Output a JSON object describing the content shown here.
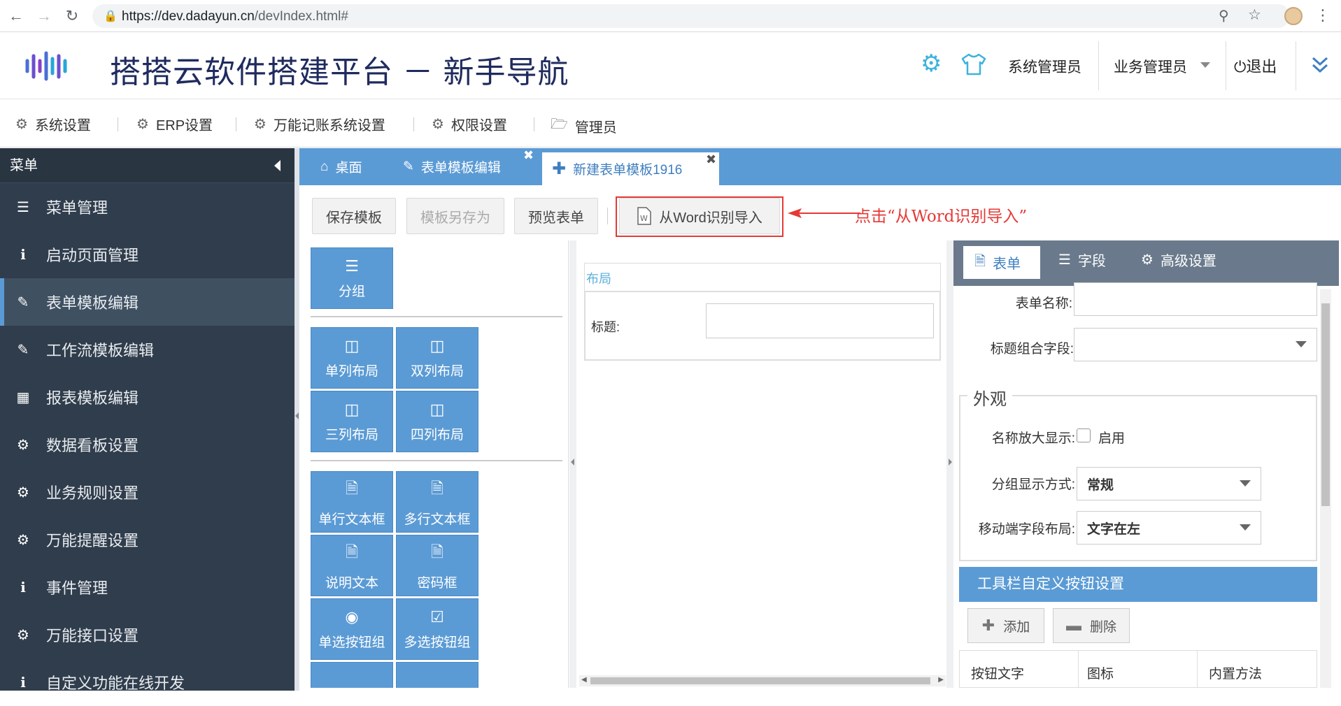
{
  "browser": {
    "url_host": "https://dev.dadayun.cn",
    "url_path": "/devIndex.html#"
  },
  "header": {
    "title": "搭搭云软件搭建平台 － 新手导航",
    "user_sys": "系统管理员",
    "user_biz": "业务管理员",
    "logout": "退出"
  },
  "topmenu": {
    "items": [
      "系统设置",
      "ERP设置",
      "万能记账系统设置",
      "权限设置",
      "管理员"
    ]
  },
  "sidebar": {
    "title": "菜单",
    "items": [
      "菜单管理",
      "启动页面管理",
      "表单模板编辑",
      "工作流模板编辑",
      "报表模板编辑",
      "数据看板设置",
      "业务规则设置",
      "万能提醒设置",
      "事件管理",
      "万能接口设置",
      "自定义功能在线开发"
    ]
  },
  "tabs": [
    "桌面",
    "表单模板编辑",
    "新建表单模板1916"
  ],
  "toolbar": {
    "save": "保存模板",
    "save_as": "模板另存为",
    "preview": "预览表单",
    "import_word": "从Word识别导入",
    "annotation": "点击“从Word识别导入”"
  },
  "palette": {
    "group": "分组",
    "layouts": [
      "单列布局",
      "双列布局",
      "三列布局",
      "四列布局"
    ],
    "fields": [
      "单行文本框",
      "多行文本框",
      "说明文本",
      "密码框",
      "单选按钮组",
      "多选按钮组"
    ]
  },
  "canvas": {
    "section": "布局",
    "title_label": "标题:"
  },
  "props": {
    "tabs": [
      "表单",
      "字段",
      "高级设置"
    ],
    "form_name_label": "表单名称:",
    "title_combo_label": "标题组合字段:",
    "appearance_legend": "外观",
    "enlarge_label": "名称放大显示:",
    "enlarge_option": "启用",
    "group_display_label": "分组显示方式:",
    "group_display_value": "常规",
    "mobile_layout_label": "移动端字段布局:",
    "mobile_layout_value": "文字在左",
    "toolbar_section": "工具栏自定义按钮设置",
    "add": "添加",
    "delete": "删除",
    "columns": [
      "按钮文字",
      "图标",
      "内置方法"
    ]
  },
  "colors": {
    "accent": "#5b9bd5",
    "sidebar": "#303d4c",
    "annotation": "#e53935"
  }
}
